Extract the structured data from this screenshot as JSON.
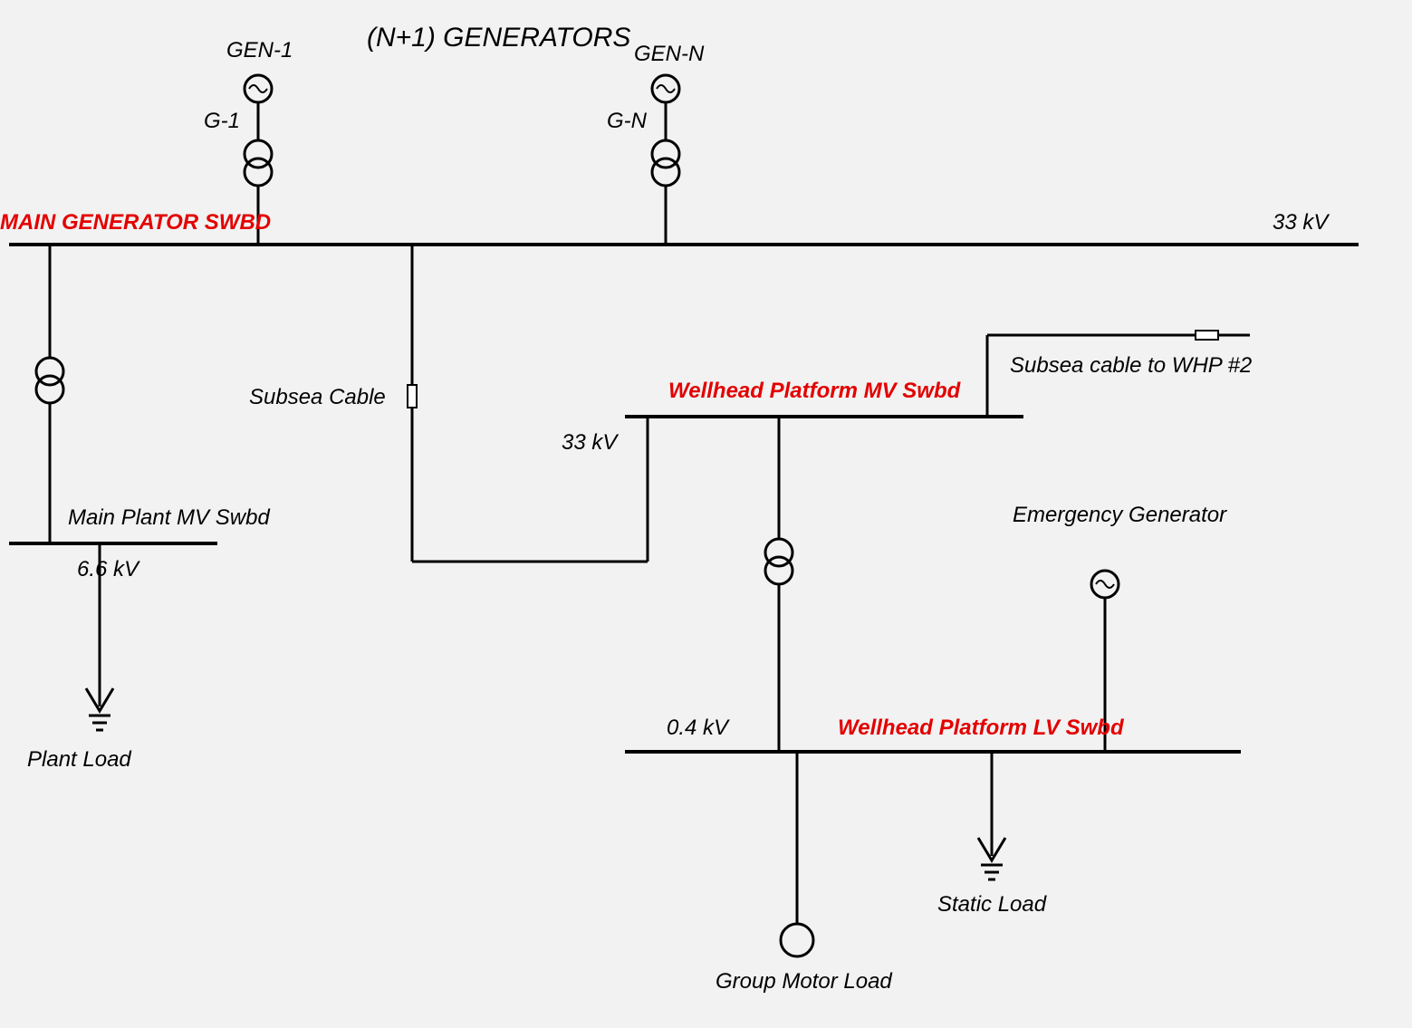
{
  "title": "(N+1) GENERATORS",
  "gen1": {
    "top": "GEN-1",
    "id": "G-1"
  },
  "genN": {
    "top": "GEN-N",
    "id": "G-N"
  },
  "bus33": {
    "name": "MAIN GENERATOR SWBD",
    "voltage": "33 kV"
  },
  "subsea_cable": "Subsea Cable",
  "subsea_to_whp2": "Subsea cable to WHP #2",
  "mv_whp": {
    "name": "Wellhead Platform MV Swbd",
    "voltage": "33 kV"
  },
  "lv_whp": {
    "name": "Wellhead Platform LV Swbd",
    "voltage": "0.4 kV"
  },
  "main_mv": {
    "name": "Main Plant MV Swbd",
    "voltage": "6.6 kV"
  },
  "plant_load": "Plant Load",
  "emergency_gen": "Emergency Generator",
  "group_motor": "Group Motor Load",
  "static_load": "Static Load"
}
